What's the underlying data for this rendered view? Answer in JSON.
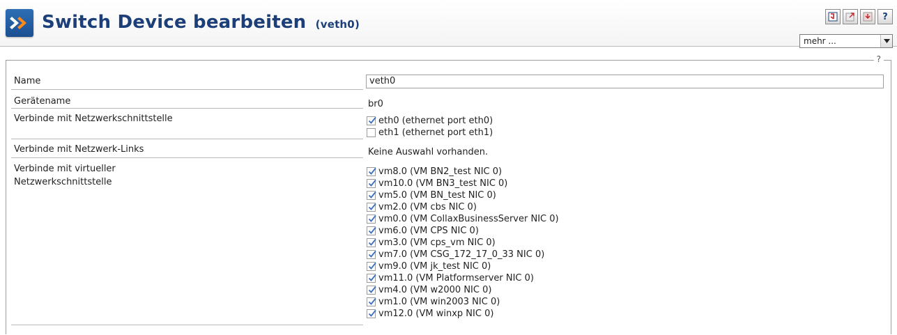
{
  "header": {
    "title": "Switch Device bearbeiten",
    "subtitle": "(veth0)",
    "more_select": "mehr ..."
  },
  "toolbar": {
    "buttons": [
      "save-icon",
      "open-external-icon",
      "download-icon"
    ],
    "help_label": "?"
  },
  "form": {
    "help_marker": "?",
    "name_label": "Name",
    "name_value": "veth0",
    "device_label": "Gerätename",
    "device_value": "br0",
    "iface_label": "Verbinde mit Netzwerkschnittstelle",
    "interfaces": [
      {
        "label": "eth0 (ethernet port eth0)",
        "checked": true
      },
      {
        "label": "eth1 (ethernet port eth1)",
        "checked": false
      }
    ],
    "links_label": "Verbinde mit Netzwerk-Links",
    "links_value": "Keine Auswahl vorhanden.",
    "virt_label_line1": "Verbinde mit virtueller",
    "virt_label_line2": "Netzwerkschnittstelle",
    "virtual_interfaces": [
      {
        "label": "vm8.0 (VM BN2_test NIC 0)",
        "checked": true
      },
      {
        "label": "vm10.0 (VM BN3_test NIC 0)",
        "checked": true
      },
      {
        "label": "vm5.0 (VM BN_test NIC 0)",
        "checked": true
      },
      {
        "label": "vm2.0 (VM cbs NIC 0)",
        "checked": true
      },
      {
        "label": "vm0.0 (VM CollaxBusinessServer NIC 0)",
        "checked": true
      },
      {
        "label": "vm6.0 (VM CPS NIC 0)",
        "checked": true
      },
      {
        "label": "vm3.0 (VM cps_vm NIC 0)",
        "checked": true
      },
      {
        "label": "vm7.0 (VM CSG_172_17_0_33 NIC 0)",
        "checked": true
      },
      {
        "label": "vm9.0 (VM jk_test NIC 0)",
        "checked": true
      },
      {
        "label": "vm11.0 (VM Platformserver NIC 0)",
        "checked": true
      },
      {
        "label": "vm4.0 (VM w2000 NIC 0)",
        "checked": true
      },
      {
        "label": "vm1.0 (VM win2003 NIC 0)",
        "checked": true
      },
      {
        "label": "vm12.0 (VM winxp NIC 0)",
        "checked": true
      }
    ]
  },
  "colors": {
    "title": "#1c3f7a",
    "logo": "#2f6fb5",
    "check": "#3a6fc0"
  }
}
